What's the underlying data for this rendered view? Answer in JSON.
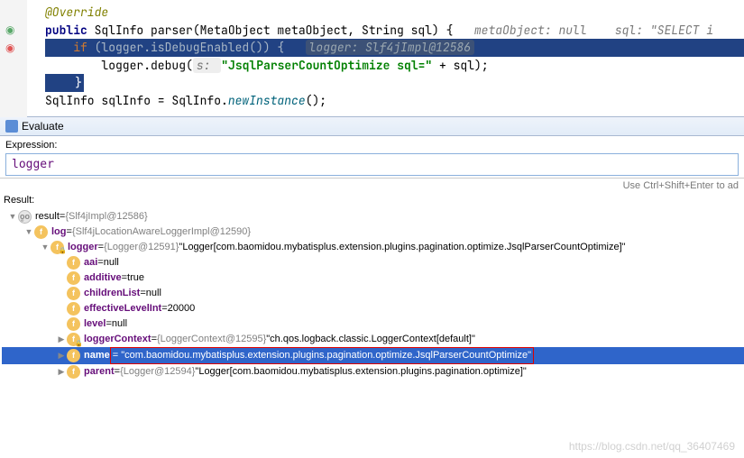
{
  "code": {
    "annotation": "@Override",
    "line2_pre": "public ",
    "line2_type1": "SqlInfo ",
    "line2_method": "parser",
    "line2_params": "(MetaObject metaObject, String sql) {",
    "hint_meta": "metaObject: null",
    "hint_sql": "sql: \"SELECT i",
    "line3_pre": "    if ",
    "line3_cond": "(logger.isDebugEnabled()) {",
    "hint_logger": "logger: Slf4jImpl@12586",
    "line4_pre": "        logger.debug(",
    "line4_hint": "s: ",
    "line4_str": "\"JsqlParserCountOptimize sql=\"",
    "line4_post": " + sql);",
    "line5": "    }",
    "line6_pre": "SqlInfo sqlInfo = SqlInfo.",
    "line6_method": "newInstance",
    "line6_post": "();"
  },
  "evaluate": {
    "title": "Evaluate"
  },
  "expression": {
    "label": "Expression:",
    "value": "logger",
    "hint": "Use Ctrl+Shift+Enter to ad"
  },
  "result_label": "Result:",
  "tree": {
    "result": {
      "name": "result",
      "eq": " = ",
      "val": "{Slf4jImpl@12586}"
    },
    "log": {
      "name": "log",
      "eq": " = ",
      "val": "{Slf4jLocationAwareLoggerImpl@12590}"
    },
    "logger_node": {
      "name": "logger",
      "eq": " = ",
      "type": "{Logger@12591} ",
      "val": "\"Logger[com.baomidou.mybatisplus.extension.plugins.pagination.optimize.JsqlParserCountOptimize]\""
    },
    "aai": {
      "name": "aai",
      "eq": " = ",
      "val": "null"
    },
    "additive": {
      "name": "additive",
      "eq": " = ",
      "val": "true"
    },
    "childrenList": {
      "name": "childrenList",
      "eq": " = ",
      "val": "null"
    },
    "effectiveLevelInt": {
      "name": "effectiveLevelInt",
      "eq": " = ",
      "val": "20000"
    },
    "level": {
      "name": "level",
      "eq": " = ",
      "val": "null"
    },
    "loggerContext": {
      "name": "loggerContext",
      "eq": " = ",
      "type": "{LoggerContext@12595} ",
      "val": "\"ch.qos.logback.classic.LoggerContext[default]\""
    },
    "name_node": {
      "name": "name",
      "eq": " = ",
      "val": "\"com.baomidou.mybatisplus.extension.plugins.pagination.optimize.JsqlParserCountOptimize\""
    },
    "parent": {
      "name": "parent",
      "eq": " = ",
      "type": "{Logger@12594} ",
      "val": "\"Logger[com.baomidou.mybatisplus.extension.plugins.pagination.optimize]\""
    }
  },
  "watermark": "https://blog.csdn.net/qq_36407469"
}
